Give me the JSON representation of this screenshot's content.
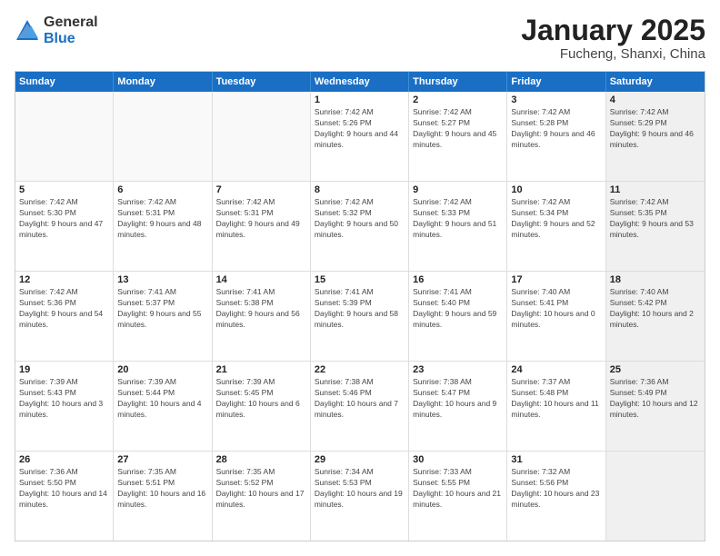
{
  "logo": {
    "general": "General",
    "blue": "Blue"
  },
  "title": "January 2025",
  "subtitle": "Fucheng, Shanxi, China",
  "dayHeaders": [
    "Sunday",
    "Monday",
    "Tuesday",
    "Wednesday",
    "Thursday",
    "Friday",
    "Saturday"
  ],
  "rows": [
    [
      {
        "day": "",
        "info": "",
        "empty": true
      },
      {
        "day": "",
        "info": "",
        "empty": true
      },
      {
        "day": "",
        "info": "",
        "empty": true
      },
      {
        "day": "1",
        "info": "Sunrise: 7:42 AM\nSunset: 5:26 PM\nDaylight: 9 hours and 44 minutes."
      },
      {
        "day": "2",
        "info": "Sunrise: 7:42 AM\nSunset: 5:27 PM\nDaylight: 9 hours and 45 minutes."
      },
      {
        "day": "3",
        "info": "Sunrise: 7:42 AM\nSunset: 5:28 PM\nDaylight: 9 hours and 46 minutes."
      },
      {
        "day": "4",
        "info": "Sunrise: 7:42 AM\nSunset: 5:29 PM\nDaylight: 9 hours and 46 minutes.",
        "shaded": true
      }
    ],
    [
      {
        "day": "5",
        "info": "Sunrise: 7:42 AM\nSunset: 5:30 PM\nDaylight: 9 hours and 47 minutes."
      },
      {
        "day": "6",
        "info": "Sunrise: 7:42 AM\nSunset: 5:31 PM\nDaylight: 9 hours and 48 minutes."
      },
      {
        "day": "7",
        "info": "Sunrise: 7:42 AM\nSunset: 5:31 PM\nDaylight: 9 hours and 49 minutes."
      },
      {
        "day": "8",
        "info": "Sunrise: 7:42 AM\nSunset: 5:32 PM\nDaylight: 9 hours and 50 minutes."
      },
      {
        "day": "9",
        "info": "Sunrise: 7:42 AM\nSunset: 5:33 PM\nDaylight: 9 hours and 51 minutes."
      },
      {
        "day": "10",
        "info": "Sunrise: 7:42 AM\nSunset: 5:34 PM\nDaylight: 9 hours and 52 minutes."
      },
      {
        "day": "11",
        "info": "Sunrise: 7:42 AM\nSunset: 5:35 PM\nDaylight: 9 hours and 53 minutes.",
        "shaded": true
      }
    ],
    [
      {
        "day": "12",
        "info": "Sunrise: 7:42 AM\nSunset: 5:36 PM\nDaylight: 9 hours and 54 minutes."
      },
      {
        "day": "13",
        "info": "Sunrise: 7:41 AM\nSunset: 5:37 PM\nDaylight: 9 hours and 55 minutes."
      },
      {
        "day": "14",
        "info": "Sunrise: 7:41 AM\nSunset: 5:38 PM\nDaylight: 9 hours and 56 minutes."
      },
      {
        "day": "15",
        "info": "Sunrise: 7:41 AM\nSunset: 5:39 PM\nDaylight: 9 hours and 58 minutes."
      },
      {
        "day": "16",
        "info": "Sunrise: 7:41 AM\nSunset: 5:40 PM\nDaylight: 9 hours and 59 minutes."
      },
      {
        "day": "17",
        "info": "Sunrise: 7:40 AM\nSunset: 5:41 PM\nDaylight: 10 hours and 0 minutes."
      },
      {
        "day": "18",
        "info": "Sunrise: 7:40 AM\nSunset: 5:42 PM\nDaylight: 10 hours and 2 minutes.",
        "shaded": true
      }
    ],
    [
      {
        "day": "19",
        "info": "Sunrise: 7:39 AM\nSunset: 5:43 PM\nDaylight: 10 hours and 3 minutes."
      },
      {
        "day": "20",
        "info": "Sunrise: 7:39 AM\nSunset: 5:44 PM\nDaylight: 10 hours and 4 minutes."
      },
      {
        "day": "21",
        "info": "Sunrise: 7:39 AM\nSunset: 5:45 PM\nDaylight: 10 hours and 6 minutes."
      },
      {
        "day": "22",
        "info": "Sunrise: 7:38 AM\nSunset: 5:46 PM\nDaylight: 10 hours and 7 minutes."
      },
      {
        "day": "23",
        "info": "Sunrise: 7:38 AM\nSunset: 5:47 PM\nDaylight: 10 hours and 9 minutes."
      },
      {
        "day": "24",
        "info": "Sunrise: 7:37 AM\nSunset: 5:48 PM\nDaylight: 10 hours and 11 minutes."
      },
      {
        "day": "25",
        "info": "Sunrise: 7:36 AM\nSunset: 5:49 PM\nDaylight: 10 hours and 12 minutes.",
        "shaded": true
      }
    ],
    [
      {
        "day": "26",
        "info": "Sunrise: 7:36 AM\nSunset: 5:50 PM\nDaylight: 10 hours and 14 minutes."
      },
      {
        "day": "27",
        "info": "Sunrise: 7:35 AM\nSunset: 5:51 PM\nDaylight: 10 hours and 16 minutes."
      },
      {
        "day": "28",
        "info": "Sunrise: 7:35 AM\nSunset: 5:52 PM\nDaylight: 10 hours and 17 minutes."
      },
      {
        "day": "29",
        "info": "Sunrise: 7:34 AM\nSunset: 5:53 PM\nDaylight: 10 hours and 19 minutes."
      },
      {
        "day": "30",
        "info": "Sunrise: 7:33 AM\nSunset: 5:55 PM\nDaylight: 10 hours and 21 minutes."
      },
      {
        "day": "31",
        "info": "Sunrise: 7:32 AM\nSunset: 5:56 PM\nDaylight: 10 hours and 23 minutes."
      },
      {
        "day": "",
        "info": "",
        "empty": true,
        "shaded": true
      }
    ]
  ]
}
